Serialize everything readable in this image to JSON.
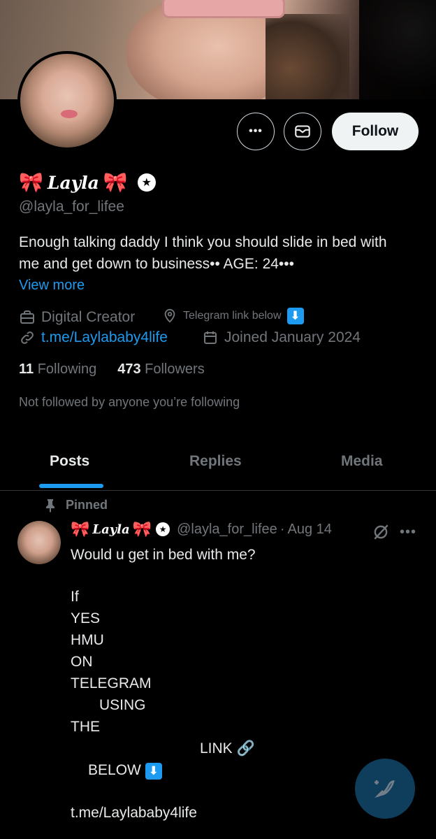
{
  "profile": {
    "name": "Layla",
    "bow_emoji": "🎀",
    "handle": "@layla_for_lifee",
    "bio": "Enough talking daddy I think you should slide in bed with me and get down to business•• AGE: 24•••",
    "view_more": "View more",
    "category": "Digital Creator",
    "location": "Telegram link below",
    "down_arrow": "⬇",
    "website": "t.me/Laylababy4life",
    "joined": "Joined January 2024",
    "following_count": "11",
    "following_label": "Following",
    "followers_count": "473",
    "followers_label": "Followers",
    "not_followed": "Not followed by anyone you’re following"
  },
  "actions": {
    "more_label": "•••",
    "follow_label": "Follow"
  },
  "tabs": [
    {
      "label": "Posts",
      "active": true
    },
    {
      "label": "Replies",
      "active": false
    },
    {
      "label": "Media",
      "active": false
    }
  ],
  "post": {
    "pinned_label": "Pinned",
    "author_name": "Layla",
    "author_handle": "@layla_for_lifee",
    "separator": "·",
    "date": "Aug 14",
    "more": "•••",
    "lines": [
      "Would u get in bed with me?",
      "If",
      "YES",
      "HMU",
      "ON",
      "TELEGRAM",
      "USING",
      "THE",
      "LINK",
      "BELOW"
    ],
    "link_emoji": "🔗",
    "link": "t.me/Laylababy4life"
  },
  "colors": {
    "accent": "#1d9bf0",
    "background": "#000000",
    "secondary_text": "#71767b",
    "primary_text": "#e7e9ea"
  }
}
